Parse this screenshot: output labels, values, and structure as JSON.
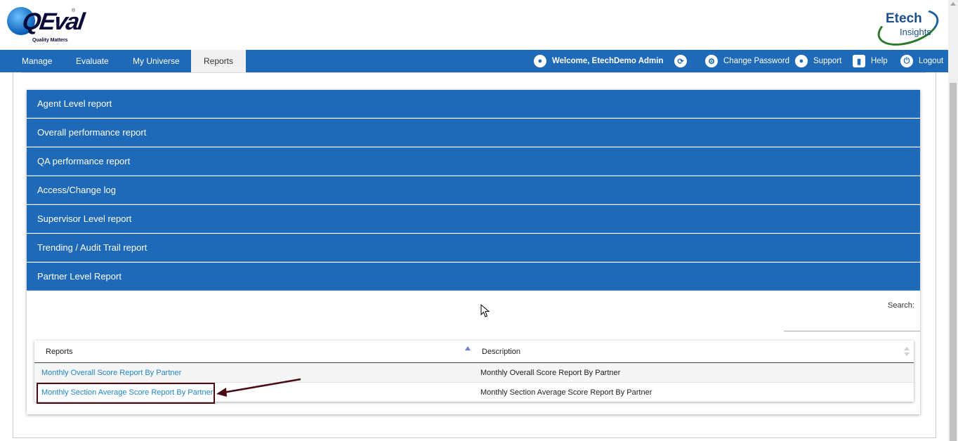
{
  "header": {
    "logo_left_text": "QEval",
    "logo_left_tagline": "Quality Matters",
    "logo_right_line1": "Etech",
    "logo_right_line2": "Insights"
  },
  "nav": {
    "items": [
      "Manage",
      "Evaluate",
      "My Universe",
      "Reports"
    ],
    "active": "Reports",
    "welcome": "Welcome, EtechDemo Admin",
    "change_password": "Change Password",
    "support": "Support",
    "help": "Help",
    "logout": "Logout"
  },
  "accordion": [
    "Agent Level report",
    "Overall performance report",
    "QA performance report",
    "Access/Change log",
    "Supervisor Level report",
    "Trending / Audit Trail report",
    "Partner Level Report"
  ],
  "table": {
    "search_label": "Search:",
    "search_value": "",
    "columns": [
      "Reports",
      "Description"
    ],
    "rows": [
      {
        "report": "Monthly Overall Score Report By Partner",
        "description": "Monthly Overall Score Report By Partner"
      },
      {
        "report": "Monthly Section Average Score Report By Partner",
        "description": "Monthly Section Average Score Report By Partner"
      }
    ]
  },
  "colors": {
    "nav_blue": "#1f6ab8",
    "link_blue": "#1f86c8",
    "annotation": "#4a0a12"
  }
}
